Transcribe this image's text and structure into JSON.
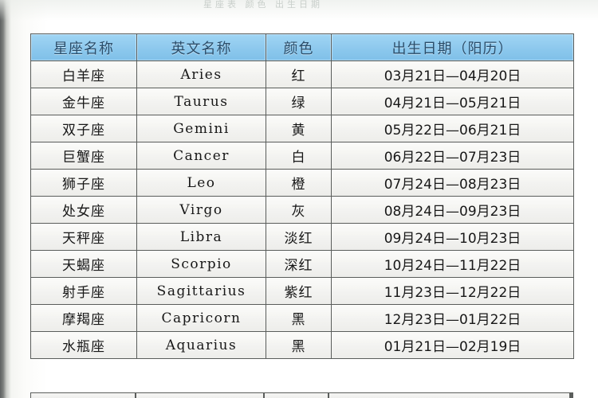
{
  "document": {
    "top_clipped_text": "星座表 颜色 出生日期",
    "table": {
      "headers": [
        "星座名称",
        "英文名称",
        "颜色",
        "出生日期（阳历）"
      ],
      "rows": [
        {
          "name": "白羊座",
          "english": "Aries",
          "color": "红",
          "date": "03月21日—04月20日"
        },
        {
          "name": "金牛座",
          "english": "Taurus",
          "color": "绿",
          "date": "04月21日—05月21日"
        },
        {
          "name": "双子座",
          "english": "Gemini",
          "color": "黄",
          "date": "05月22日—06月21日"
        },
        {
          "name": "巨蟹座",
          "english": "Cancer",
          "color": "白",
          "date": "06月22日—07月23日"
        },
        {
          "name": "狮子座",
          "english": "Leo",
          "color": "橙",
          "date": "07月24日—08月23日"
        },
        {
          "name": "处女座",
          "english": "Virgo",
          "color": "灰",
          "date": "08月24日—09月23日"
        },
        {
          "name": "天秤座",
          "english": "Libra",
          "color": "淡红",
          "date": "09月24日—10月23日"
        },
        {
          "name": "天蝎座",
          "english": "Scorpio",
          "color": "深红",
          "date": "10月24日—11月22日"
        },
        {
          "name": "射手座",
          "english": "Sagittarius",
          "color": "紫红",
          "date": "11月23日—12月22日"
        },
        {
          "name": "摩羯座",
          "english": "Capricorn",
          "color": "黑",
          "date": "12月23日—01月22日"
        },
        {
          "name": "水瓶座",
          "english": "Aquarius",
          "color": "黑",
          "date": "01月21日—02月19日"
        }
      ]
    },
    "colors": {
      "header_blue": "#8cc5e9",
      "header_text": "#2d4f6b",
      "cell_background": "#efefed",
      "grid_line": "#5b5e5c",
      "page_background": "#ffffff"
    }
  }
}
